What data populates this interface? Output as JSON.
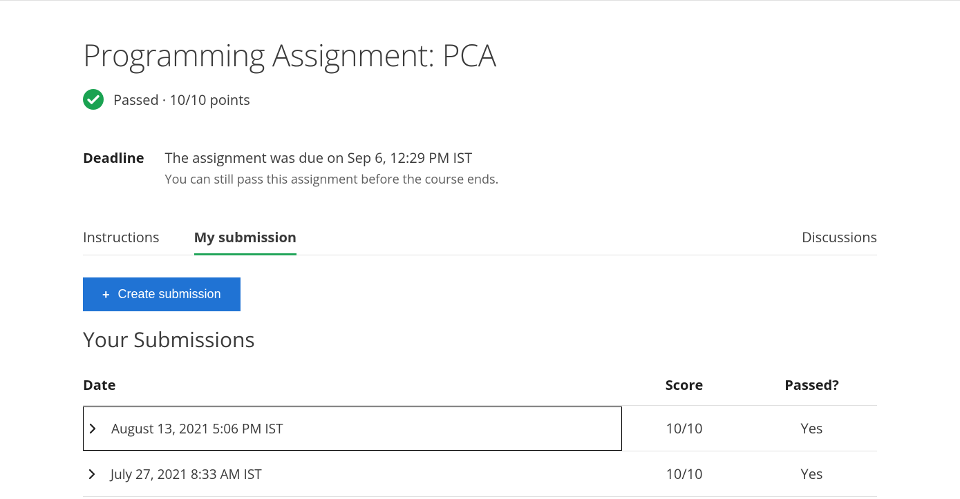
{
  "header": {
    "title": "Programming Assignment: PCA",
    "status": "Passed · 10/10 points"
  },
  "deadline": {
    "label": "Deadline",
    "main": "The assignment was due on Sep 6, 12:29 PM IST",
    "sub": "You can still pass this assignment before the course ends."
  },
  "tabs": {
    "instructions": "Instructions",
    "my_submission": "My submission",
    "discussions": "Discussions"
  },
  "actions": {
    "create_submission": "Create submission"
  },
  "section": {
    "title": "Your Submissions"
  },
  "table": {
    "headers": {
      "date": "Date",
      "score": "Score",
      "passed": "Passed?"
    },
    "rows": [
      {
        "date": "August 13, 2021 5:06 PM IST",
        "score": "10/10",
        "passed": "Yes"
      },
      {
        "date": "July 27, 2021 8:33 AM IST",
        "score": "10/10",
        "passed": "Yes"
      }
    ]
  }
}
